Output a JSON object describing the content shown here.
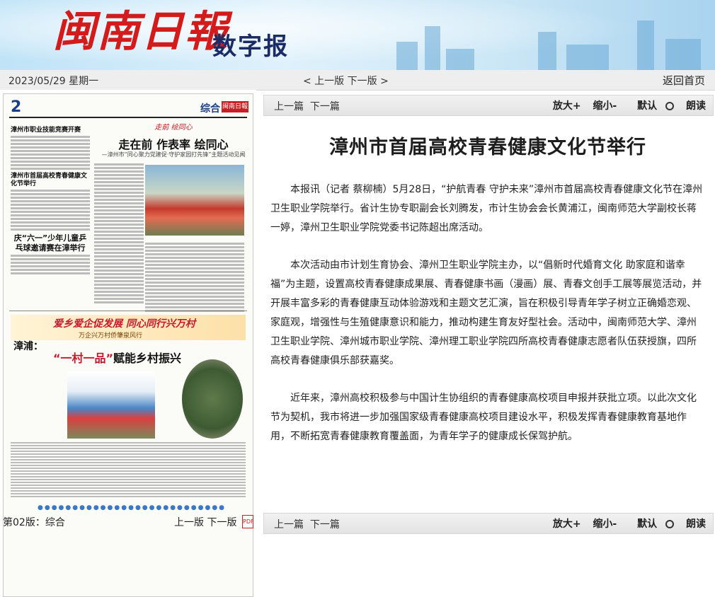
{
  "header": {
    "logo_text": "闽南日報",
    "logo_sub": "数字报"
  },
  "topbar": {
    "date": "2023/05/29 星期一",
    "prev_page": "< 上一版",
    "next_page": "下一版 >",
    "home": "返回首页"
  },
  "thumbnail": {
    "page_number": "2",
    "section": "综合",
    "brand": "闽南日報",
    "red_banner": "走前 绘同心",
    "main_title": "走在前 作表率 绘同心",
    "main_subtitle": "—漳州市“同心聚力党建促·守护家园打先锋”主题活动见闻",
    "headline_1": "漳州市职业技能竞赛开赛",
    "headline_2": "漳州市首届高校青春健康文化节举行",
    "headline_3": "庆“六一”少年儿童乒乓球邀请赛在漳举行",
    "ad_title": "爱乡爱企促发展 同心同行兴万村",
    "ad_subtitle": "万企兴万村侨肇泉风行",
    "ad_label": "漳浦：",
    "ad_headline_red": "“一村一品”",
    "ad_headline_rest": "赋能乡村振兴",
    "dots": "●●●●●●●●●●●●●●●●●●●●●●●●●●●"
  },
  "pagebar": {
    "page_name": "第02版：综合",
    "prev_page": "上一版",
    "next_page": "下一版",
    "pdf_icon": "pdf-icon"
  },
  "toolbar": {
    "prev_article": "上一篇",
    "next_article": "下一篇",
    "zoom_in": "放大+",
    "zoom_out": "缩小-",
    "default": "默认",
    "read_aloud": "朗读"
  },
  "article": {
    "title": "漳州市首届高校青春健康文化节举行",
    "paragraphs": [
      "本报讯（记者 蔡柳楠）5月28日，“护航青春 守护未来”漳州市首届高校青春健康文化节在漳州卫生职业学院举行。省计生协专职副会长刘腾发，市计生协会会长黄浦江，闽南师范大学副校长蒋一婷，漳州卫生职业学院党委书记陈超出席活动。",
      "本次活动由市计划生育协会、漳州卫生职业学院主办，以“倡新时代婚育文化 助家庭和谐幸福”为主题，设置高校青春健康成果展、青春健康书画（漫画）展、青春文创手工展等展览活动，并开展丰富多彩的青春健康互动体验游戏和主题文艺汇演，旨在积极引导青年学子树立正确婚恋观、家庭观，增强性与生殖健康意识和能力，推动构建生育友好型社会。活动中，闽南师范大学、漳州卫生职业学院、漳州城市职业学院、漳州理工职业学院四所高校青春健康志愿者队伍获授旗，四所高校青春健康俱乐部获嘉奖。",
      "近年来，漳州高校积极参与中国计生协组织的青春健康高校项目申报并获批立项。以此次文化节为契机，我市将进一步加强国家级青春健康高校项目建设水平，积极发挥青春健康教育基地作用，不断拓宽青春健康教育覆盖面，为青年学子的健康成长保驾护航。"
    ]
  },
  "colors": {
    "logo_red": "#d41b1b",
    "brand_blue": "#1b2b66",
    "section_blue": "#1a3d8a",
    "topbar_bg": "#eeeeee"
  }
}
